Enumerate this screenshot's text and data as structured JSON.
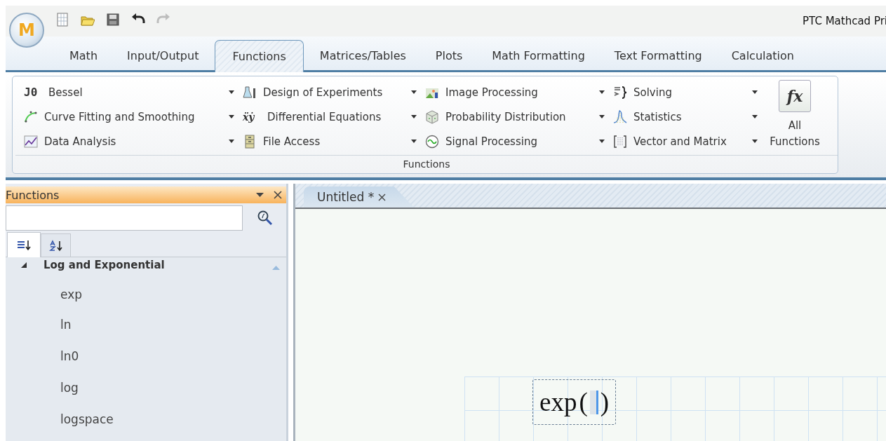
{
  "app": {
    "logo": "M",
    "title": "PTC Mathcad Pri"
  },
  "quick_access": [
    {
      "kind": "new",
      "disabled": false
    },
    {
      "kind": "open",
      "disabled": false
    },
    {
      "kind": "save",
      "disabled": false
    },
    {
      "kind": "undo",
      "disabled": false
    },
    {
      "kind": "redo",
      "disabled": true
    }
  ],
  "tabs": [
    {
      "label": "Math",
      "selected": false
    },
    {
      "label": "Input/Output",
      "selected": false
    },
    {
      "label": "Functions",
      "selected": true
    },
    {
      "label": "Matrices/Tables",
      "selected": false
    },
    {
      "label": "Plots",
      "selected": false
    },
    {
      "label": "Math Formatting",
      "selected": false
    },
    {
      "label": "Text Formatting",
      "selected": false
    },
    {
      "label": "Calculation",
      "selected": false
    }
  ],
  "ribbon": {
    "group_label": "Functions",
    "columns": [
      [
        {
          "label": "Bessel",
          "kind": "glyph",
          "glyph": "J0"
        },
        {
          "label": "Curve Fitting and Smoothing",
          "kind": "curve"
        },
        {
          "label": "Data Analysis",
          "kind": "chart"
        }
      ],
      [
        {
          "label": "Design of Experiments",
          "kind": "flask"
        },
        {
          "label": "Differential Equations",
          "kind": "glyph2",
          "glyph": "ẍẏ"
        },
        {
          "label": "File Access",
          "kind": "cabinet"
        }
      ],
      [
        {
          "label": "Image Processing",
          "kind": "image"
        },
        {
          "label": "Probability Distribution",
          "kind": "cube"
        },
        {
          "label": "Signal Processing",
          "kind": "wave"
        }
      ],
      [
        {
          "label": "Solving",
          "kind": "solve"
        },
        {
          "label": "Statistics",
          "kind": "bell"
        },
        {
          "label": "Vector and Matrix",
          "kind": "matrix"
        }
      ]
    ],
    "all_functions": {
      "glyph": "fx",
      "label": "All Functions"
    }
  },
  "functions_panel": {
    "title": "Functions",
    "sort_tabs": [
      {
        "kind": "category",
        "selected": true
      },
      {
        "kind": "alpha",
        "selected": false
      }
    ],
    "tree": [
      {
        "label": "Log and Exponential",
        "expanded": true,
        "children": [
          {
            "label": "exp"
          },
          {
            "label": "ln"
          },
          {
            "label": "ln0"
          },
          {
            "label": "log"
          },
          {
            "label": "logspace"
          }
        ]
      }
    ]
  },
  "document": {
    "tab": {
      "label": "Untitled *",
      "selected": true
    },
    "math": {
      "function": "exp",
      "open": "(",
      "close": ")"
    }
  }
}
